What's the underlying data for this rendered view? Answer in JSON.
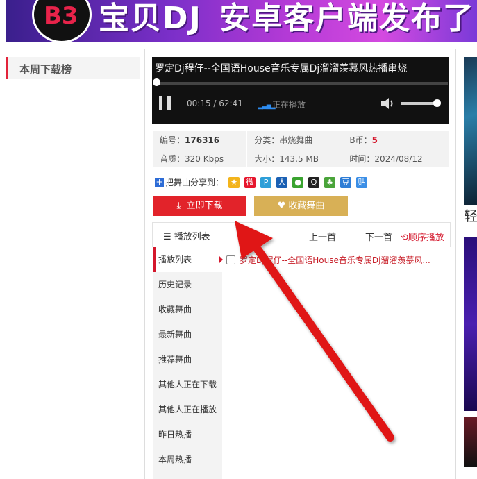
{
  "banner": {
    "logo": "B3",
    "title1": "宝贝DJ",
    "title2": "安卓客户端发布了!!"
  },
  "left": {
    "heading": "本周下载榜"
  },
  "player": {
    "title": "罗定Dj程仔--全国语House音乐专属Dj溜溜羡慕风热播串烧",
    "time": "00:15 / 62:41",
    "status": "正在播放",
    "progress": 0.004,
    "volume": 0.9
  },
  "info": {
    "id_label": "编号：",
    "id_value": "176316",
    "category_label": "分类：",
    "category_value": "串烧舞曲",
    "coin_label": "B币：",
    "coin_value": "5",
    "quality_label": "音质：",
    "quality_value": "320 Kbps",
    "size_label": "大小：",
    "size_value": "143.5 MB",
    "date_label": "时间：",
    "date_value": "2024/08/12"
  },
  "share": {
    "label": "把舞曲分享到：",
    "icons": [
      "qzone-icon",
      "weibo-icon",
      "tencent-weibo-icon",
      "renren-icon",
      "wechat-icon",
      "qq-icon",
      "kaixin-icon",
      "douban-icon",
      "tieba-icon"
    ]
  },
  "buttons": {
    "download": "立即下载",
    "favorite": "收藏舞曲"
  },
  "playlist": {
    "tab": "播放列表",
    "prev": "上一首",
    "next": "下一首",
    "order": "顺序播放",
    "side": [
      "播放列表",
      "历史记录",
      "收藏舞曲",
      "最新舞曲",
      "推荐舞曲",
      "其他人正在下载",
      "其他人正在播放",
      "昨日热播",
      "本周热播"
    ],
    "songs": [
      {
        "name": "罗定Dj程仔--全国语House音乐专属Dj溜溜羡慕风...",
        "dash": "—"
      }
    ]
  },
  "colors": {
    "accent_red": "#e2232a",
    "gold": "#d8b056",
    "player_bg": "#111111"
  }
}
